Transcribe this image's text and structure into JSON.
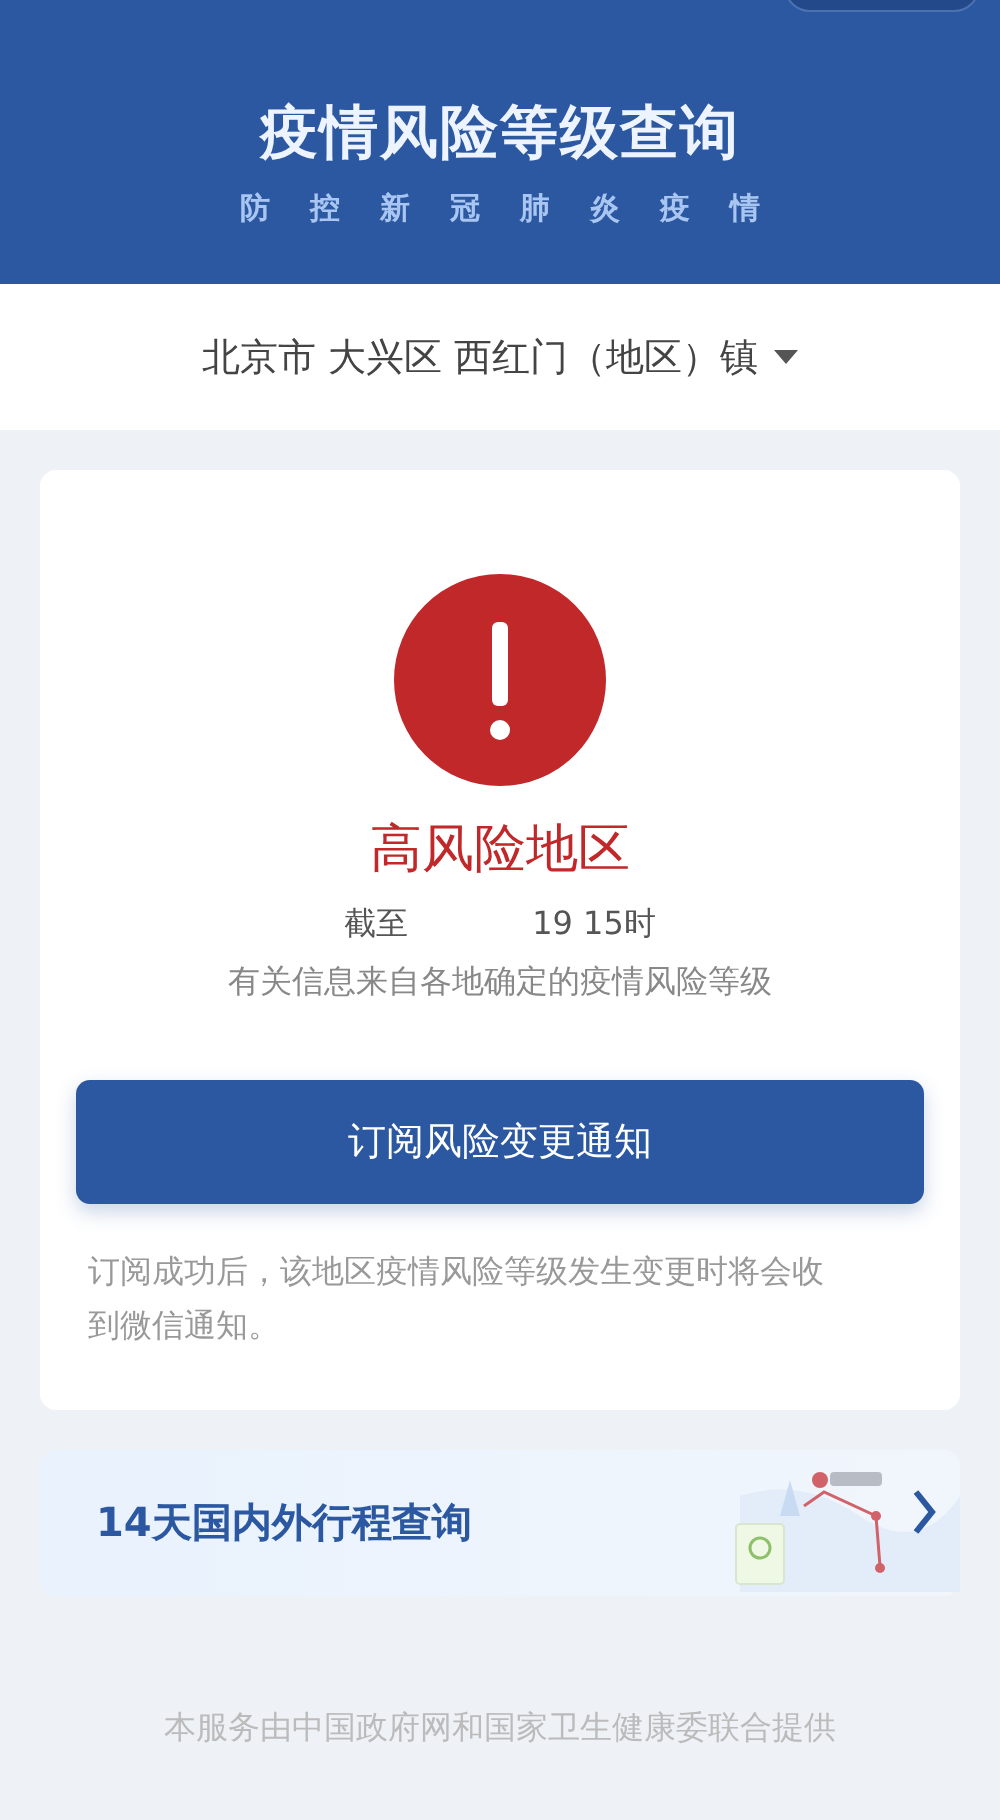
{
  "header": {
    "title": "疫情风险等级查询",
    "subtitle": "防控新冠肺炎疫情"
  },
  "location": {
    "text": "北京市 大兴区 西红门（地区）镇"
  },
  "result": {
    "risk_label": "高风险地区",
    "date_start": "截至",
    "date_end": "19 15时",
    "source_note": "有关信息来自各地确定的疫情风险等级"
  },
  "subscribe": {
    "button": "订阅风险变更通知",
    "note": "订阅成功后，该地区疫情风险等级发生变更时将会收到微信通知。"
  },
  "trip": {
    "label": "14天国内外行程查询"
  },
  "footer": "本服务由中国政府网和国家卫生健康委联合提供"
}
